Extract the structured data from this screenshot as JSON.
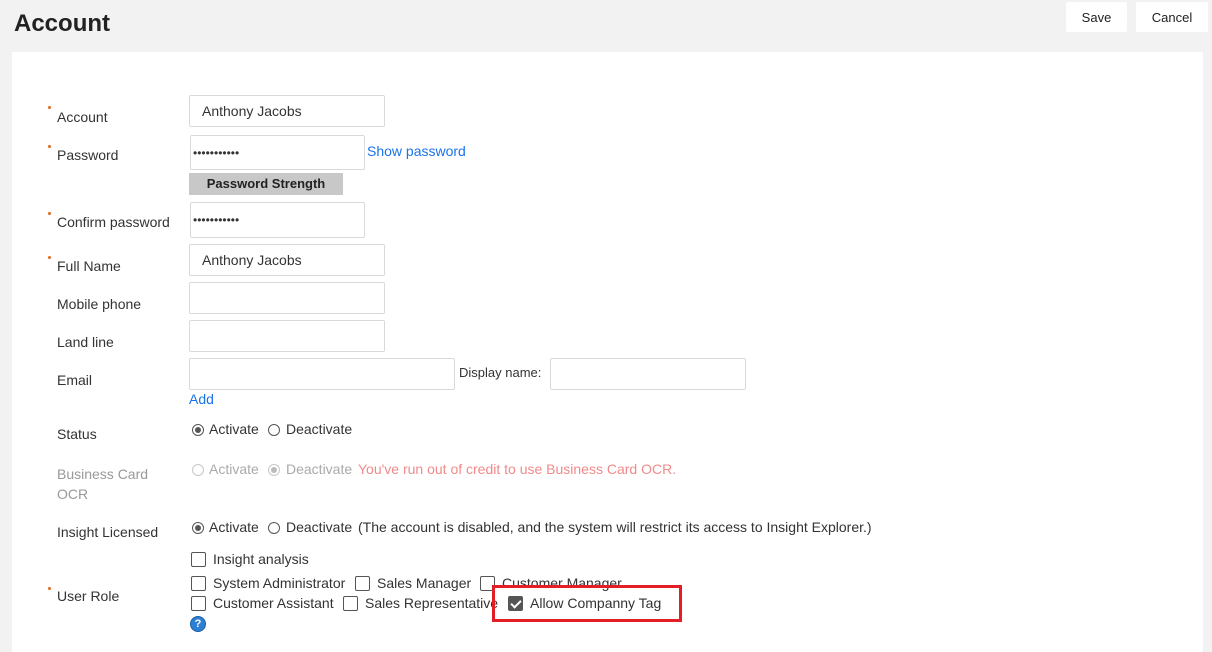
{
  "header": {
    "title": "Account",
    "save_label": "Save",
    "cancel_label": "Cancel"
  },
  "form": {
    "account": {
      "label": "Account",
      "value": "Anthony Jacobs"
    },
    "password": {
      "label": "Password",
      "value": "•••••••••••",
      "show_link": "Show password",
      "strength_label": "Password Strength"
    },
    "confirm_password": {
      "label": "Confirm password",
      "value": "•••••••••••"
    },
    "full_name": {
      "label": "Full Name",
      "value": "Anthony Jacobs"
    },
    "mobile_phone": {
      "label": "Mobile phone",
      "value": ""
    },
    "land_line": {
      "label": "Land line",
      "value": ""
    },
    "email": {
      "label": "Email",
      "value": "",
      "display_name_label": "Display name:",
      "display_name_value": "",
      "add_link": "Add"
    },
    "status": {
      "label": "Status",
      "activate": "Activate",
      "deactivate": "Deactivate",
      "selected": "Activate"
    },
    "business_card_ocr": {
      "label_line1": "Business Card",
      "label_line2": "OCR",
      "activate": "Activate",
      "deactivate": "Deactivate",
      "selected": "Deactivate",
      "message": "You've run out of credit to use Business Card OCR."
    },
    "insight_licensed": {
      "label": "Insight Licensed",
      "activate": "Activate",
      "deactivate": "Deactivate",
      "selected": "Activate",
      "note": "(The account is disabled, and the system will restrict its access to Insight Explorer.)"
    },
    "user_role": {
      "label": "User Role",
      "options": [
        {
          "label": "Insight analysis",
          "checked": false
        },
        {
          "label": "System Administrator",
          "checked": false
        },
        {
          "label": "Sales Manager",
          "checked": false
        },
        {
          "label": "Customer Manager",
          "checked": false
        },
        {
          "label": "Customer Assistant",
          "checked": false
        },
        {
          "label": "Sales Representative",
          "checked": false
        },
        {
          "label": "Allow Companny Tag",
          "checked": true
        }
      ],
      "help_icon": "question-circle-icon"
    }
  },
  "colors": {
    "required_marker": "#e26a1d",
    "link": "#1a73e8",
    "highlight": "#e31e24",
    "warning_text": "#f08a8a"
  }
}
